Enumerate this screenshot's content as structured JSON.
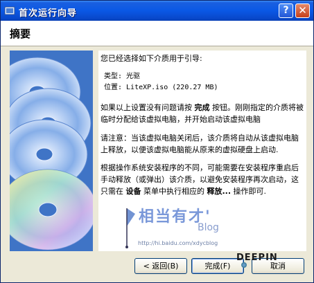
{
  "window": {
    "title": "首次运行向导"
  },
  "header": {
    "title": "摘要"
  },
  "content": {
    "intro": "您已经选择如下介质用于引导:",
    "type_line": "类型:  光驱",
    "location_line": "位置:  LiteXP.iso (220.27 MB)",
    "para1_pre": "如果以上设置没有问题请按 ",
    "para1_bold": "完成",
    "para1_post": " 按钮。刚刚指定的介质将被临时分配给该虚拟电脑，并开始启动该虚拟电脑",
    "para2": "请注意：当该虚拟电脑关闭后，该介质将自动从该虚拟电脑上释放，以便该虚拟电脑能从原来的虚拟硬盘上启动.",
    "para3_a": "根据操作系统安装程序的不同，可能需要在安装程序重启后手动释放（或弹出）该介质，以避免安装程序再次启动，这只需在 ",
    "para3_bold1": "设备",
    "para3_b": " 菜单中执行相应的 ",
    "para3_bold2": "释放...",
    "para3_c": " 操作即可."
  },
  "watermark": {
    "text": "相当有才'",
    "blog": "Blog",
    "url": "http://hi.baidu.com/xdycblog",
    "brand": "DEEPIN"
  },
  "buttons": {
    "back": "< 返回(B)",
    "finish": "完成(F)",
    "cancel": "取消"
  },
  "colors": {
    "title_bar": "#0a58e5",
    "side_panel": "#3f74c6"
  },
  "icons": {
    "app": "virtualbox-icon",
    "help": "help-icon",
    "close": "close-icon"
  }
}
